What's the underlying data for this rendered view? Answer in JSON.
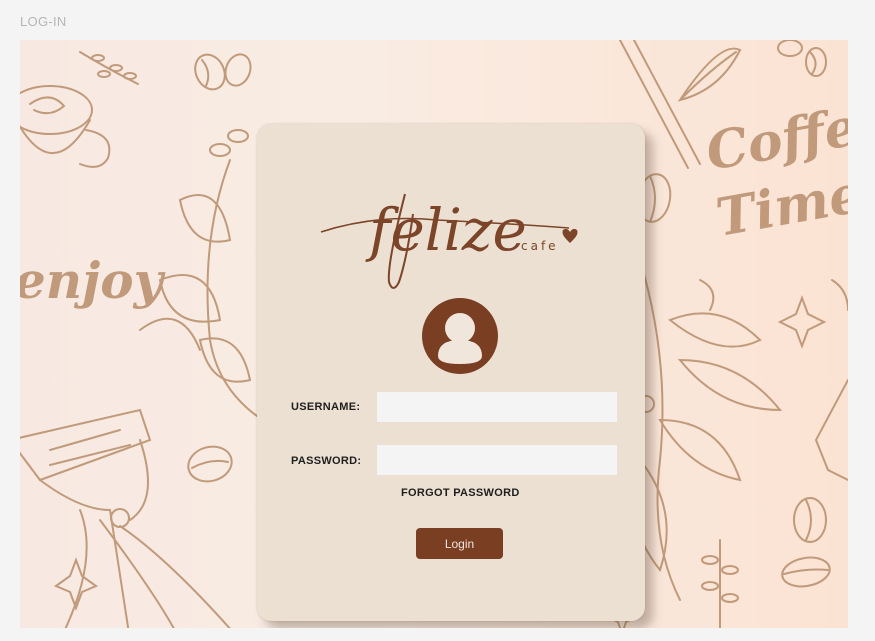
{
  "frame": {
    "label": "LOG-IN"
  },
  "brand": {
    "name": "felize",
    "tagline": "cafe"
  },
  "background": {
    "doodle_words": [
      "enjoy",
      "Coffee",
      "Time"
    ],
    "colors": {
      "doodle": "#c09a7a",
      "gradient_start": "#f7e9e1",
      "gradient_end": "#fbe3d3"
    }
  },
  "form": {
    "username_label": "USERNAME",
    "username_colon": ":",
    "username_value": "",
    "password_label": "PASSWORD",
    "password_colon": ":",
    "password_value": "",
    "forgot_link": "FORGOT PASSWORD",
    "login_button": "Login"
  },
  "icons": {
    "avatar": "user-avatar-icon",
    "heart": "coffee-bean-heart-icon"
  },
  "colors": {
    "card": "#ece0d3",
    "accent": "#7a3e22",
    "input": "#f4f4f4"
  }
}
